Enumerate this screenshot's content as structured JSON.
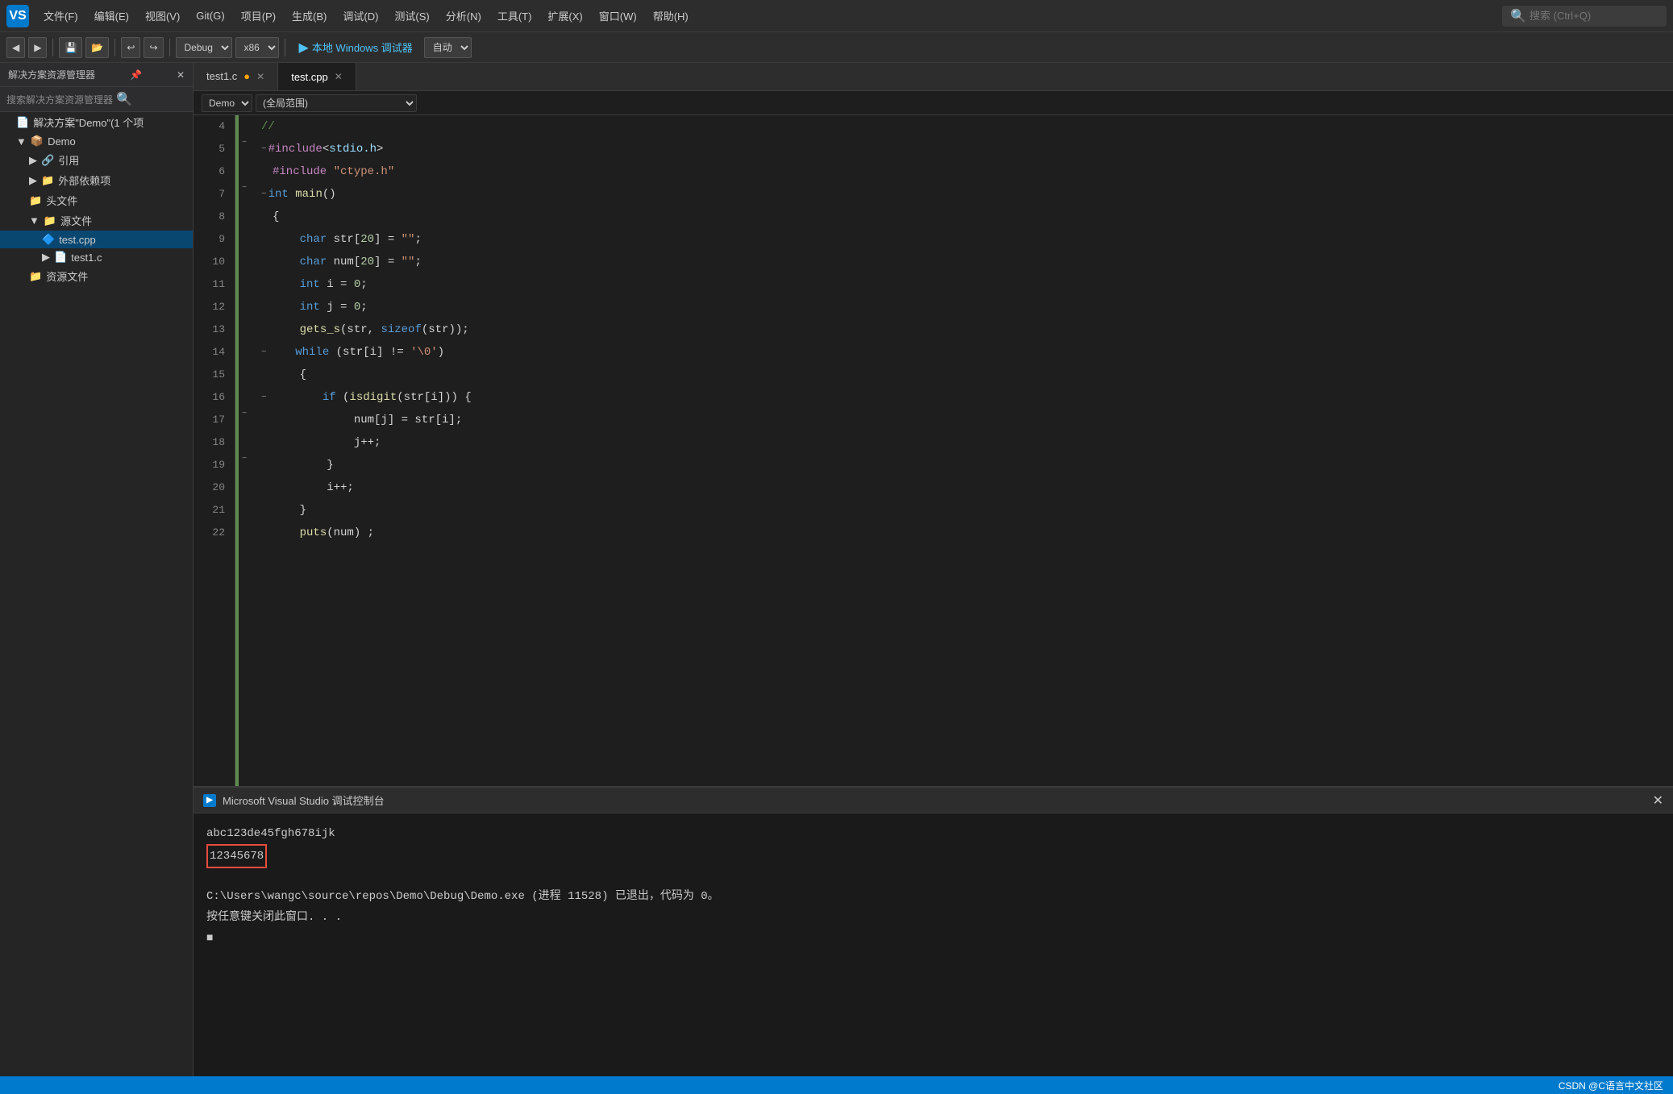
{
  "menubar": {
    "logo": "VS",
    "items": [
      "文件(F)",
      "编辑(E)",
      "视图(V)",
      "Git(G)",
      "项目(P)",
      "生成(B)",
      "调试(D)",
      "测试(S)",
      "分析(N)",
      "工具(T)",
      "扩展(X)",
      "窗口(W)",
      "帮助(H)"
    ],
    "search_placeholder": "搜索 (Ctrl+Q)"
  },
  "toolbar": {
    "back": "←",
    "forward": "→",
    "config_select": "Debug",
    "platform_select": "x86",
    "run_label": "本地 Windows 调试器",
    "run_mode": "自动"
  },
  "sidebar": {
    "header": "解决方案资源管理器",
    "search_placeholder": "搜索解决方案资源管理器",
    "tree": [
      {
        "level": 0,
        "icon": "📄",
        "label": "解决方案\"Demo\"(1 个项",
        "type": "solution"
      },
      {
        "level": 1,
        "icon": "📦",
        "label": "Demo",
        "type": "project",
        "expanded": true
      },
      {
        "level": 2,
        "icon": "📁",
        "label": "引用",
        "type": "folder"
      },
      {
        "level": 2,
        "icon": "📁",
        "label": "外部依赖项",
        "type": "folder"
      },
      {
        "level": 2,
        "icon": "📁",
        "label": "头文件",
        "type": "folder"
      },
      {
        "level": 2,
        "icon": "📁",
        "label": "源文件",
        "type": "folder",
        "expanded": true
      },
      {
        "level": 3,
        "icon": "🔷",
        "label": "test.cpp",
        "type": "file",
        "selected": true
      },
      {
        "level": 3,
        "icon": "📄",
        "label": "test1.c",
        "type": "file"
      },
      {
        "level": 2,
        "icon": "📁",
        "label": "资源文件",
        "type": "folder"
      }
    ]
  },
  "tabs": [
    {
      "label": "test1.c",
      "active": false,
      "modified": true
    },
    {
      "label": "test.cpp",
      "active": true,
      "modified": false
    }
  ],
  "breadcrumb": {
    "scope": "Demo",
    "range": "(全局范围)"
  },
  "code": {
    "lines": [
      {
        "num": 4,
        "content": "//",
        "type": "comment"
      },
      {
        "num": 5,
        "content": "#include<stdio.h>",
        "type": "include"
      },
      {
        "num": 6,
        "content": "#include \"ctype.h\"",
        "type": "include"
      },
      {
        "num": 7,
        "content": "int main()",
        "type": "code"
      },
      {
        "num": 8,
        "content": "{",
        "type": "code"
      },
      {
        "num": 9,
        "content": "    char str[20] = \"\";",
        "type": "code"
      },
      {
        "num": 10,
        "content": "    char num[20] = \"\";",
        "type": "code"
      },
      {
        "num": 11,
        "content": "    int i = 0;",
        "type": "code"
      },
      {
        "num": 12,
        "content": "    int j = 0;",
        "type": "code"
      },
      {
        "num": 13,
        "content": "    gets_s(str, sizeof(str));",
        "type": "code"
      },
      {
        "num": 14,
        "content": "    while (str[i] != '\\0')",
        "type": "code"
      },
      {
        "num": 15,
        "content": "    {",
        "type": "code"
      },
      {
        "num": 16,
        "content": "        if (isdigit(str[i])) {",
        "type": "code"
      },
      {
        "num": 17,
        "content": "            num[j] = str[i];",
        "type": "code"
      },
      {
        "num": 18,
        "content": "            j++;",
        "type": "code"
      },
      {
        "num": 19,
        "content": "        }",
        "type": "code"
      },
      {
        "num": 20,
        "content": "        i++;",
        "type": "code"
      },
      {
        "num": 21,
        "content": "    }",
        "type": "code"
      },
      {
        "num": 22,
        "content": "    puts(num);",
        "type": "code"
      }
    ]
  },
  "console": {
    "title": "Microsoft Visual Studio 调试控制台",
    "output_line1": "abc123de45fgh678ijk",
    "output_line2": "12345678",
    "path_line": "C:\\Users\\wangc\\source\\repos\\Demo\\Debug\\Demo.exe (进程 11528) 已退出，代码为 0。",
    "prompt_line": "按任意键关闭此窗口. . .",
    "cursor": "■"
  },
  "statusbar": {
    "branding": "CSDN @C语言中文社区"
  }
}
